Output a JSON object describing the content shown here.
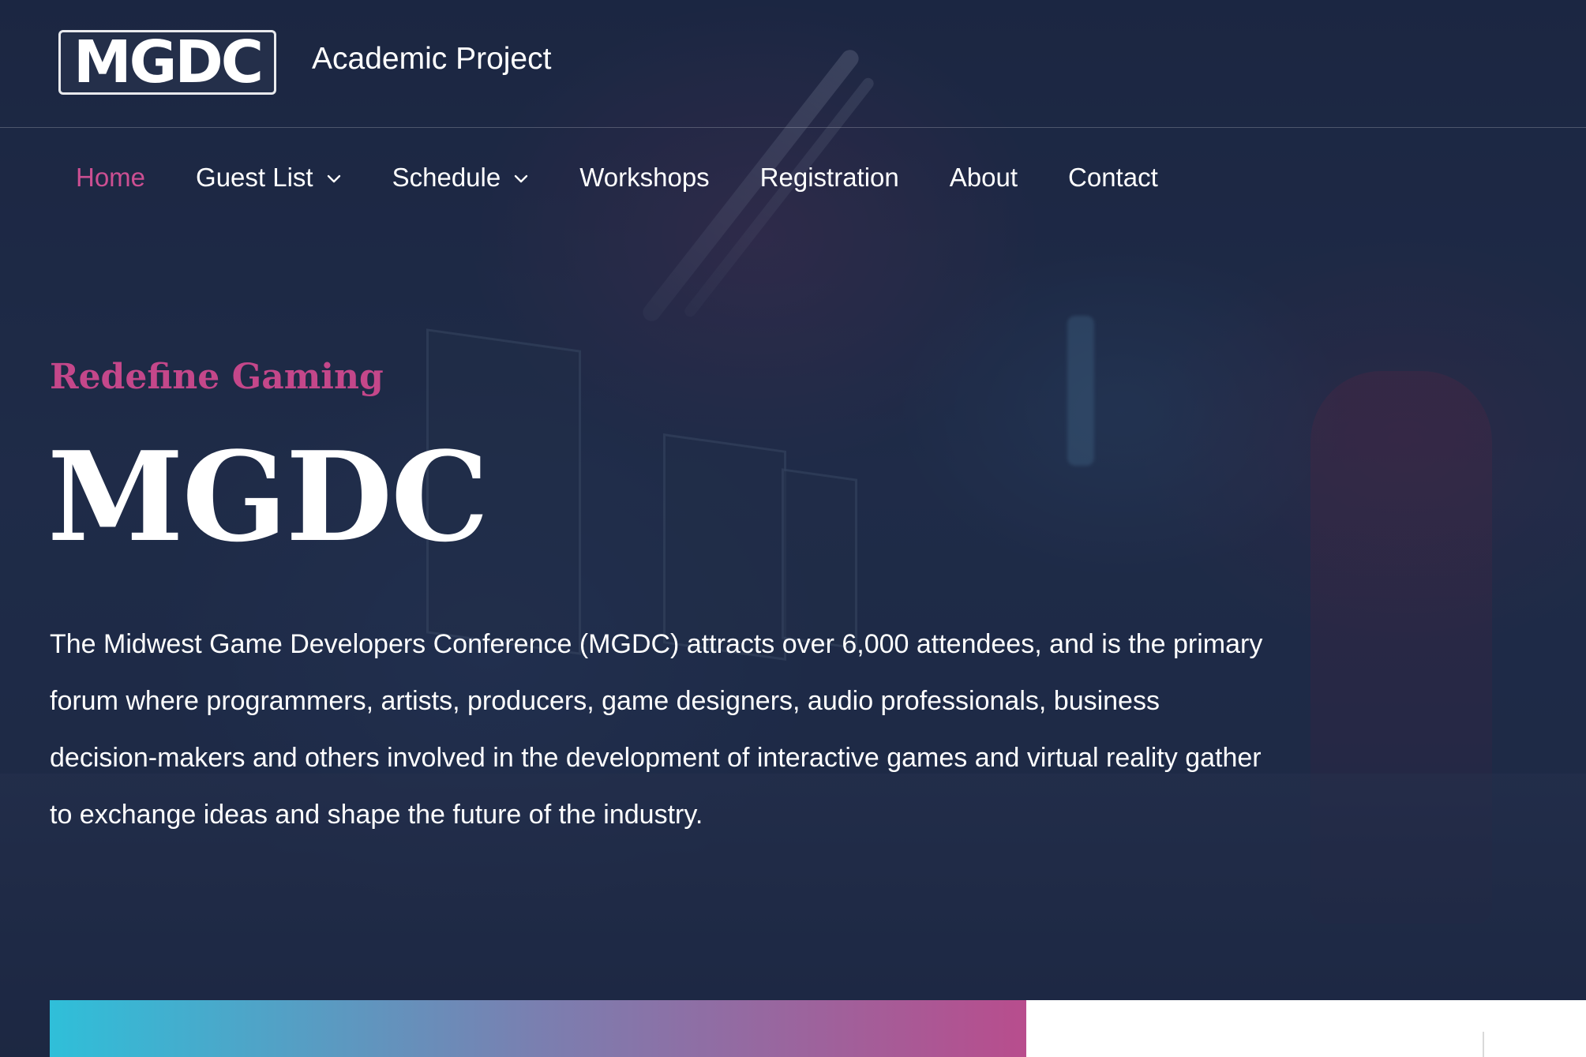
{
  "header": {
    "logo_text": "MGDC",
    "site_title": "Academic Project"
  },
  "nav": {
    "items": [
      {
        "label": "Home",
        "active": true,
        "has_dropdown": false
      },
      {
        "label": "Guest List",
        "active": false,
        "has_dropdown": true
      },
      {
        "label": "Schedule",
        "active": false,
        "has_dropdown": true
      },
      {
        "label": "Workshops",
        "active": false,
        "has_dropdown": false
      },
      {
        "label": "Registration",
        "active": false,
        "has_dropdown": false
      },
      {
        "label": "About",
        "active": false,
        "has_dropdown": false
      },
      {
        "label": "Contact",
        "active": false,
        "has_dropdown": false
      }
    ]
  },
  "hero": {
    "tagline": "Redefine Gaming",
    "title": "MGDC",
    "body": "The Midwest Game Developers Conference (MGDC) attracts over 6,000 attendees, and is the primary forum where programmers, artists, producers, game designers, audio professionals, business decision-makers and others involved in the development of interactive games and virtual reality gather to exchange ideas and shape the future of the industry."
  },
  "colors": {
    "accent": "#c4478a",
    "active_nav": "#cc4f92",
    "background": "#1e2a45",
    "gradient_start": "#2fbfd9",
    "gradient_end": "#b84d8d"
  }
}
